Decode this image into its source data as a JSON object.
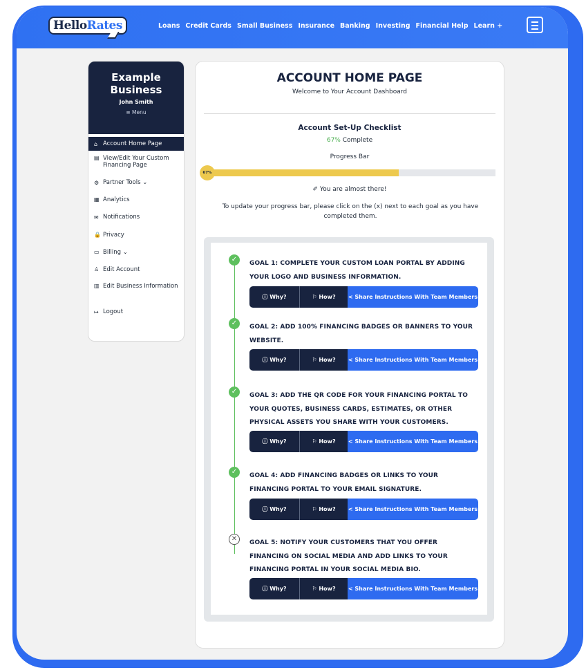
{
  "brand": {
    "logo_part1": "Hello",
    "logo_part2": "Rates",
    "accent": "#2e6bf0",
    "navy": "#18233f",
    "success": "#5ec05e",
    "progress": "#edc94e"
  },
  "nav": [
    "Loans",
    "Credit Cards",
    "Small Business",
    "Insurance",
    "Banking",
    "Investing",
    "Financial Help",
    "Learn +"
  ],
  "sidebar": {
    "business_name": "Example Business",
    "user_name": "John Smith",
    "menu_label": "≡ Menu",
    "items": [
      {
        "icon": "home-icon",
        "glyph": "⌂",
        "label": "Account Home Page"
      },
      {
        "icon": "page-icon",
        "glyph": "▤",
        "label": "View/Edit Your Custom Financing Page"
      },
      {
        "icon": "tools-icon",
        "glyph": "⚙",
        "label": "Partner Tools ⌄"
      },
      {
        "icon": "analytics-icon",
        "glyph": "▦",
        "label": "Analytics"
      },
      {
        "icon": "mail-icon",
        "glyph": "✉",
        "label": "Notifications"
      },
      {
        "icon": "lock-icon",
        "glyph": "🔒",
        "label": "Privacy"
      },
      {
        "icon": "card-icon",
        "glyph": "▭",
        "label": "Billing ⌄"
      },
      {
        "icon": "user-icon",
        "glyph": "♙",
        "label": "Edit Account"
      },
      {
        "icon": "building-icon",
        "glyph": "▥",
        "label": "Edit Business Information"
      },
      {
        "icon": "logout-icon",
        "glyph": "↦",
        "label": "Logout"
      }
    ]
  },
  "main": {
    "title": "ACCOUNT HOME PAGE",
    "subtitle": "Welcome to Your Account Dashboard",
    "checklist_title": "Account Set-Up Checklist",
    "percent": "67%",
    "percent_suffix": " Complete",
    "progress_label": "Progress Bar",
    "progress_value": 0.67,
    "progress_badge": "67%",
    "almost_text": "✐ You are almost there!",
    "instructions": "To update your progress bar, please click on the (x) next to each goal as you have completed them."
  },
  "goals": [
    {
      "text": "GOAL 1: COMPLETE YOUR CUSTOM LOAN PORTAL BY ADDING YOUR LOGO AND BUSINESS INFORMATION.",
      "status": "complete",
      "why": "ⓘ Why?",
      "how": "⚐ How?",
      "share": "< Share Instructions With Team Members"
    },
    {
      "text": "GOAL 2: ADD 100% FINANCING BADGES OR BANNERS TO YOUR WEBSITE.",
      "status": "complete",
      "why": "ⓘ Why?",
      "how": "⚐ How?",
      "share": "< Share Instructions With Team Members"
    },
    {
      "text": "GOAL 3: ADD THE QR CODE FOR YOUR FINANCING PORTAL TO YOUR QUOTES, BUSINESS CARDS, ESTIMATES, OR OTHER PHYSICAL ASSETS YOU SHARE WITH YOUR CUSTOMERS.",
      "status": "complete",
      "why": "ⓘ Why?",
      "how": "⚐ How?",
      "share": "< Share Instructions With Team Members"
    },
    {
      "text": "GOAL 4: ADD FINANCING BADGES OR LINKS TO YOUR FINANCING PORTAL TO YOUR EMAIL SIGNATURE.",
      "status": "complete",
      "why": "ⓘ Why?",
      "how": "⚐ How?",
      "share": "< Share Instructions With Team Members"
    },
    {
      "text": "GOAL 5: NOTIFY YOUR CUSTOMERS THAT YOU OFFER FINANCING ON SOCIAL MEDIA AND ADD LINKS TO YOUR FINANCING PORTAL IN YOUR SOCIAL MEDIA BIO.",
      "status": "pending",
      "why": "ⓘ Why?",
      "how": "⚐ How?",
      "share": "< Share Instructions With Team Members"
    }
  ]
}
